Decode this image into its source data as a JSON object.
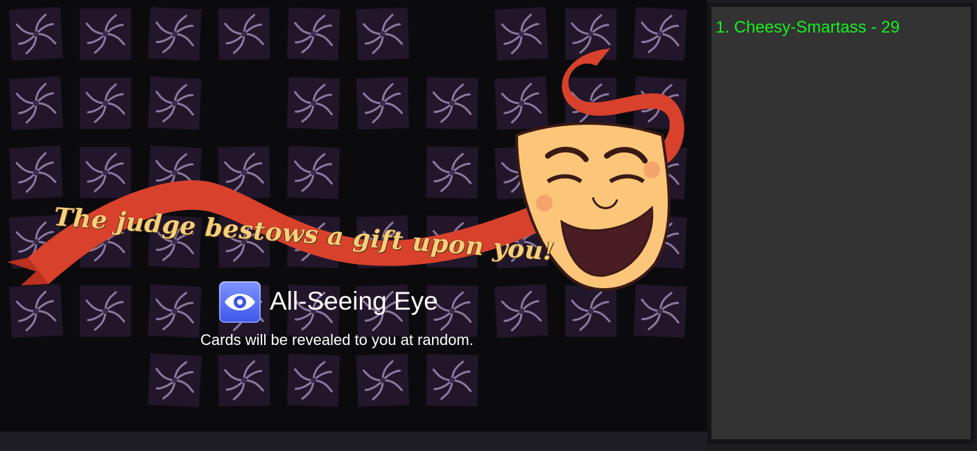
{
  "board": {
    "card_back_icon": "pinwheel-card-back-icon",
    "banner_text": "The judge bestows a gift upon you!",
    "mask_icon": "comedy-mask-icon",
    "power": {
      "icon": "eye-icon",
      "icon_color": "#5b72f5",
      "title": "All-Seeing Eye",
      "description": "Cards will be revealed to you at random."
    }
  },
  "scoreboard": {
    "entries": [
      {
        "text": "1. Cheesy-Smartass - 29",
        "color": "#17f01f"
      }
    ]
  }
}
